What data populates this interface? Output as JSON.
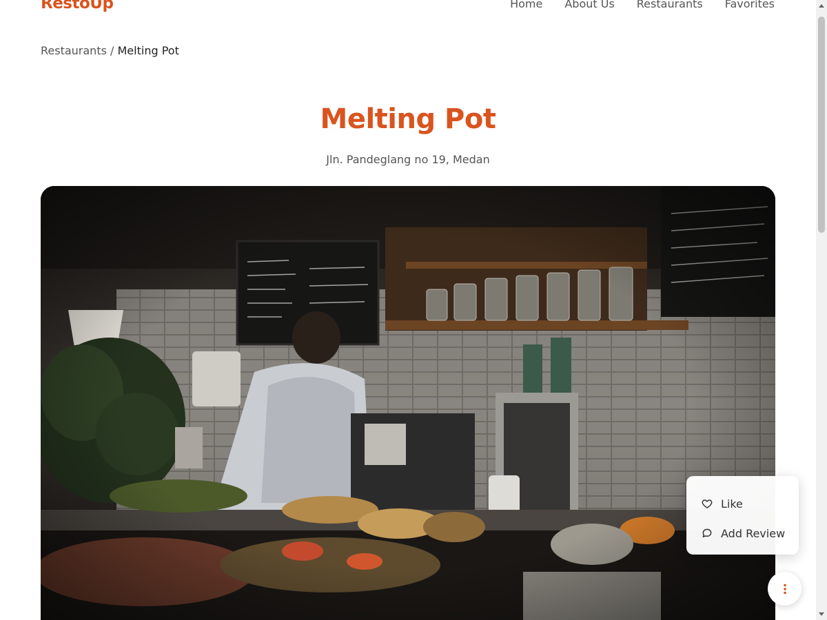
{
  "header": {
    "brand": "RestoUp",
    "nav": [
      "Home",
      "About Us",
      "Restaurants",
      "Favorites"
    ]
  },
  "breadcrumb": {
    "parent": "Restaurants",
    "separator": " / ",
    "current": "Melting Pot"
  },
  "restaurant": {
    "name": "Melting Pot",
    "address": "Jln. Pandeglang no 19, Medan"
  },
  "fab_menu": {
    "like_label": "Like",
    "review_label": "Add Review"
  },
  "colors": {
    "accent": "#d9541e",
    "text": "#555555"
  },
  "icons": {
    "like": "heart-icon",
    "review": "comment-icon",
    "fab": "more-vertical-icon"
  }
}
